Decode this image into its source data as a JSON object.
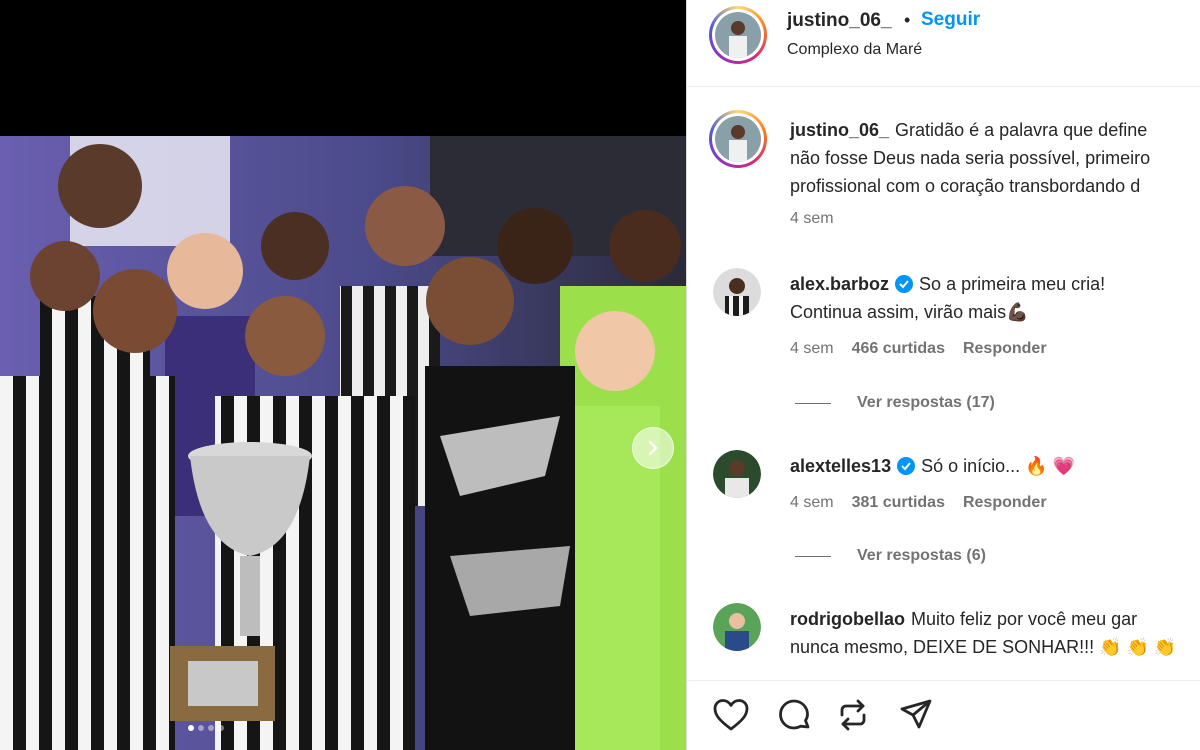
{
  "post": {
    "username": "justino_06_",
    "follow_label": "Seguir",
    "separator": "•",
    "location": "Complexo da Maré",
    "caption_lines": [
      "Gratidão é a palavra que define",
      "não fosse Deus nada seria possível, primeiro",
      "profissional com o coração transbordando d"
    ],
    "caption_time": "4 sem"
  },
  "comments": [
    {
      "username": "alex.barboz",
      "verified": true,
      "lines": [
        "So a primeira meu cria!",
        "Continua assim, virão mais💪🏿"
      ],
      "time": "4 sem",
      "likes": "466 curtidas",
      "reply_label": "Responder",
      "view_replies": "Ver respostas (17)"
    },
    {
      "username": "alextelles13",
      "verified": true,
      "lines": [
        "Só o início... 🔥 💗"
      ],
      "time": "4 sem",
      "likes": "381 curtidas",
      "reply_label": "Responder",
      "view_replies": "Ver respostas (6)"
    },
    {
      "username": "rodrigobellao",
      "verified": false,
      "lines": [
        "Muito feliz por você meu gar",
        "nunca mesmo, DEIXE DE SONHAR!!! 👏 👏 👏"
      ]
    }
  ],
  "actions": {
    "icons": [
      "heart-icon",
      "comment-icon",
      "repost-icon",
      "share-icon"
    ]
  },
  "carousel": {
    "slides": 4,
    "active": 1
  },
  "colors": {
    "accent": "#0095f6",
    "muted": "#737373",
    "text": "#262626"
  }
}
